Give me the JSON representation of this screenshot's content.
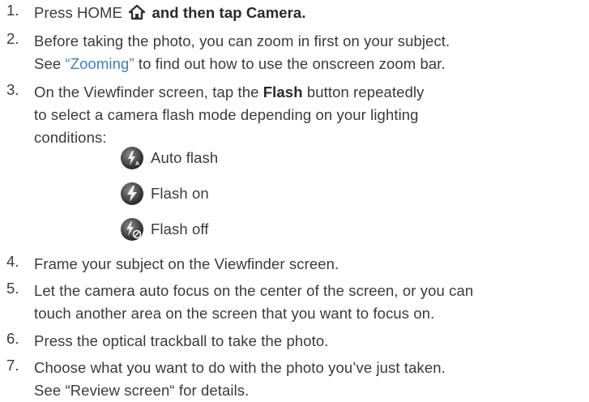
{
  "steps": [
    {
      "num": "1.",
      "pre": "Press HOME",
      "post": "and then tap Camera."
    },
    {
      "num": "2.",
      "line1": "Before taking the photo, you can zoom in first on your subject.",
      "line2_pre": "See ",
      "line2_link": "“Zooming”",
      "line2_post": " to find out how to use the onscreen zoom bar."
    },
    {
      "num": "3.",
      "line1_pre": "On the Viewfinder screen, tap the ",
      "line1_bold": "Flash",
      "line1_post": " button repeatedly",
      "line2": "to select a camera flash mode depending on your lighting",
      "line3": "conditions:"
    },
    {
      "num": "4.",
      "text": "Frame your subject on the Viewfinder screen."
    },
    {
      "num": "5.",
      "line1": "Let the camera auto focus on the center of the screen, or you can",
      "line2": "touch another area on the screen that you want to focus on."
    },
    {
      "num": "6.",
      "text": "Press the optical trackball to take the photo."
    },
    {
      "num": "7.",
      "line1": "Choose what you want to do with the photo you’ve just taken.",
      "line2": "See “Review screen“ for details."
    }
  ],
  "flash_modes": [
    {
      "label": "Auto flash",
      "icon": "auto-flash-icon"
    },
    {
      "label": "Flash on",
      "icon": "flash-on-icon"
    },
    {
      "label": "Flash off",
      "icon": "flash-off-icon"
    }
  ],
  "icons": {
    "home": "home-icon"
  }
}
